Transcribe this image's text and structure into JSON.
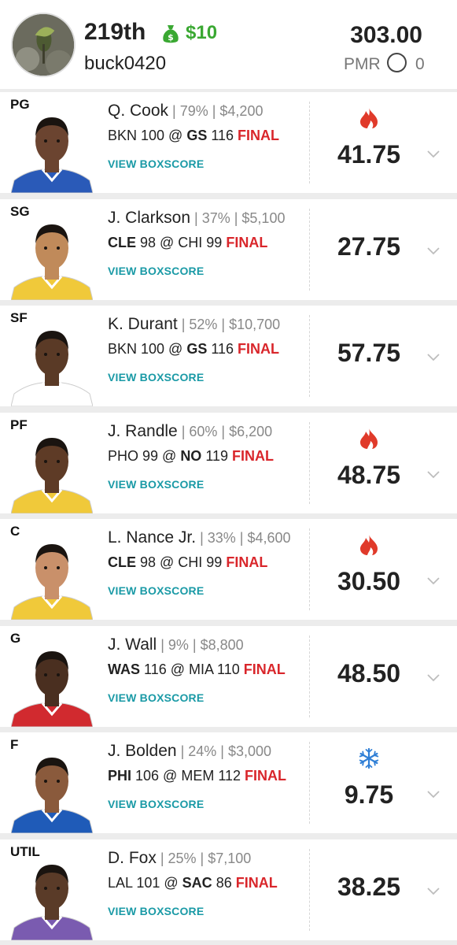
{
  "header": {
    "rank": "219th",
    "prize": "$10",
    "username": "buck0420",
    "total": "303.00",
    "pmr_label": "PMR",
    "pmr_value": "0"
  },
  "lineup": [
    {
      "pos": "PG",
      "name": "Q. Cook",
      "meta": "| 79% | $4,200",
      "away": "BKN",
      "away_score": "100",
      "home": "GS",
      "home_score": "116",
      "bold_team": "home",
      "status": "FINAL",
      "boxscore": "VIEW BOXSCORE",
      "points": "41.75",
      "badge": "fire",
      "jersey": "#2a5ab8"
    },
    {
      "pos": "SG",
      "name": "J. Clarkson",
      "meta": "| 37% | $5,100",
      "away": "CLE",
      "away_score": "98",
      "home": "CHI",
      "home_score": "99",
      "bold_team": "away",
      "status": "FINAL",
      "boxscore": "VIEW BOXSCORE",
      "points": "27.75",
      "badge": "",
      "jersey": "#f0c93a"
    },
    {
      "pos": "SF",
      "name": "K. Durant",
      "meta": "| 52% | $10,700",
      "away": "BKN",
      "away_score": "100",
      "home": "GS",
      "home_score": "116",
      "bold_team": "home",
      "status": "FINAL",
      "boxscore": "VIEW BOXSCORE",
      "points": "57.75",
      "badge": "",
      "jersey": "#ffffff"
    },
    {
      "pos": "PF",
      "name": "J. Randle",
      "meta": "| 60% | $6,200",
      "away": "PHO",
      "away_score": "99",
      "home": "NO",
      "home_score": "119",
      "bold_team": "home",
      "status": "FINAL",
      "boxscore": "VIEW BOXSCORE",
      "points": "48.75",
      "badge": "fire",
      "jersey": "#f0c93a"
    },
    {
      "pos": "C",
      "name": "L. Nance Jr.",
      "meta": "| 33% | $4,600",
      "away": "CLE",
      "away_score": "98",
      "home": "CHI",
      "home_score": "99",
      "bold_team": "away",
      "status": "FINAL",
      "boxscore": "VIEW BOXSCORE",
      "points": "30.50",
      "badge": "fire",
      "jersey": "#f0c93a"
    },
    {
      "pos": "G",
      "name": "J. Wall",
      "meta": "| 9% | $8,800",
      "away": "WAS",
      "away_score": "116",
      "home": "MIA",
      "home_score": "110",
      "bold_team": "away",
      "status": "FINAL",
      "boxscore": "VIEW BOXSCORE",
      "points": "48.50",
      "badge": "",
      "jersey": "#d12a2f"
    },
    {
      "pos": "F",
      "name": "J. Bolden",
      "meta": "| 24% | $3,000",
      "away": "PHI",
      "away_score": "106",
      "home": "MEM",
      "home_score": "112",
      "bold_team": "away",
      "status": "FINAL",
      "boxscore": "VIEW BOXSCORE",
      "points": "9.75",
      "badge": "ice",
      "jersey": "#1f5bb8"
    },
    {
      "pos": "UTIL",
      "name": "D. Fox",
      "meta": "| 25% | $7,100",
      "away": "LAL",
      "away_score": "101",
      "home": "SAC",
      "home_score": "86",
      "bold_team": "home",
      "status": "FINAL",
      "boxscore": "VIEW BOXSCORE",
      "points": "38.25",
      "badge": "",
      "jersey": "#7a5bb0"
    }
  ],
  "colors": {
    "final_red": "#d9262b",
    "prize_green": "#3aa832",
    "link_teal": "#1a9aa6",
    "fire": "#e03a2a",
    "ice": "#2f7fd6"
  }
}
